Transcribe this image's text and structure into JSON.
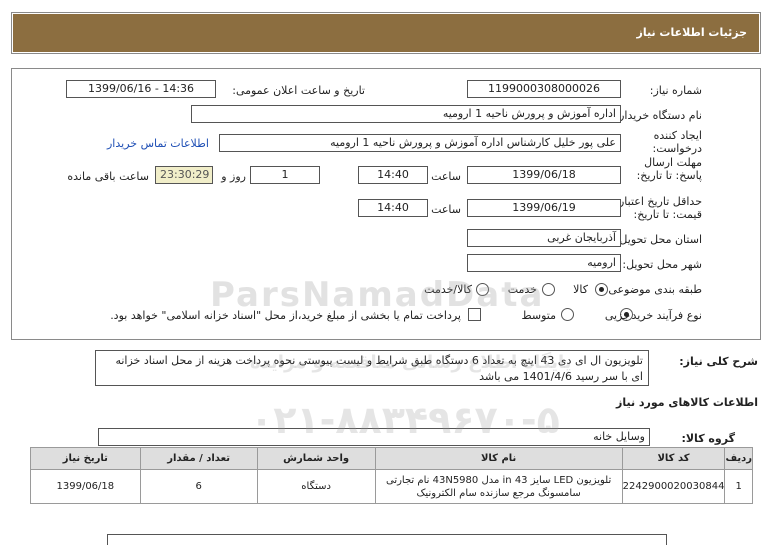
{
  "header": {
    "title": "جزئیات اطلاعات نیاز"
  },
  "form": {
    "need_number_label": "شماره نیاز:",
    "need_number": "1199000308000026",
    "announce_label": "تاریخ و ساعت اعلان عمومی:",
    "announce_value": "1399/06/16 - 14:36",
    "buyer_org_label": "نام دستگاه خریدار:",
    "buyer_org": "اداره آموزش و پرورش ناحیه 1 ارومیه",
    "creator_label": "ایجاد کننده درخواست:",
    "creator": "علی پور خلیل کارشناس اداره آموزش و پرورش ناحیه 1 ارومیه",
    "contact_link": "اطلاعات تماس خریدار",
    "deadline_label": "مهلت ارسال پاسخ: تا تاریخ:",
    "deadline_date": "1399/06/18",
    "time_label": "ساعت",
    "deadline_time": "14:40",
    "day_count": "1",
    "day_and_label": "روز و",
    "remaining_time": "23:30:29",
    "remaining_label": "ساعت باقی مانده",
    "validity_label": "حداقل تاریخ اعتبار قیمت: تا تاریخ:",
    "validity_date": "1399/06/19",
    "validity_time": "14:40",
    "province_label": "استان محل تحویل:",
    "province": "آذربایجان غربی",
    "city_label": "شهر محل تحویل:",
    "city": "ارومیه",
    "category_label": "طبقه بندی موضوعی:",
    "category_options": [
      "کالا",
      "خدمت",
      "کالا/خدمت"
    ],
    "process_label": "نوع فرآیند خرید :",
    "process_options": [
      "جزیی",
      "متوسط"
    ],
    "payment_note": "پرداخت تمام یا بخشی از مبلغ خرید،از محل \"اسناد خزانه اسلامی\" خواهد بود."
  },
  "description": {
    "label": "شرح کلی نیاز:",
    "text": "تلویزیون ال ای دی 43 اینچ  به تعداد 6 دستگاه طبق شرایط و لیست پیوستی  نحوه پرداخت هزینه از محل اسناد خزانه ای  با سر رسید 1401/4/6 می باشد"
  },
  "goods": {
    "section_title": "اطلاعات کالاهای مورد نیاز",
    "group_label": "گروه کالا:",
    "group_value": "وسایل خانه",
    "columns": [
      "ردیف",
      "کد کالا",
      "نام کالا",
      "واحد شمارش",
      "تعداد / مقدار",
      "تاریخ نیاز"
    ],
    "rows": [
      {
        "index": "1",
        "code": "2242900020030844",
        "name": "تلویزیون LED سایز 43 in مدل 43N5980 نام تجارتی سامسونگ مرجع سازنده سام الکترونیک",
        "unit": "دستگاه",
        "qty": "6",
        "date": "1399/06/18"
      }
    ]
  },
  "watermark": {
    "brand": "ParsNamadData",
    "subtitle": "پایگاه اطلاع رسانی مناقصه و مزایده",
    "phone": "۰۲۱-۸۸۳۴۹۶۷۰-۵"
  },
  "colors": {
    "header_bg": "#8c6e40",
    "link": "#1f4fb5",
    "timer_bg": "#f1eec9"
  }
}
